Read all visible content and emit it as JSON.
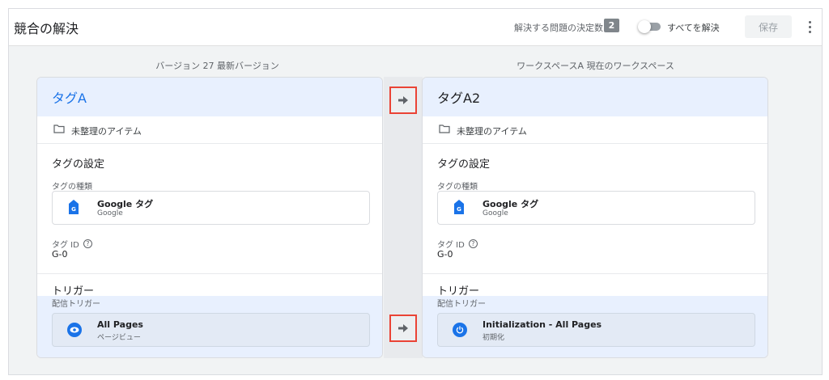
{
  "header": {
    "title": "競合の解決",
    "count_label": "解決する問題の決定数",
    "count_value": "2",
    "resolve_all_label": "すべてを解決",
    "save_label": "保存"
  },
  "columns": {
    "left_heading": "バージョン 27  最新バージョン",
    "right_heading": "ワークスペースA  現在のワークスペース"
  },
  "left": {
    "tag_name": "タグA",
    "folder": "未整理のアイテム",
    "settings_title": "タグの設定",
    "type_label": "タグの種類",
    "tag_type_name": "Google タグ",
    "tag_type_sub": "Google",
    "id_label": "タグ ID",
    "id_value": "G-0",
    "trigger_title": "トリガー",
    "firing_label": "配信トリガー",
    "trigger_name": "All Pages",
    "trigger_sub": "ページビュー",
    "trigger_icon": "eye-icon"
  },
  "right": {
    "tag_name": "タグA2",
    "folder": "未整理のアイテム",
    "settings_title": "タグの設定",
    "type_label": "タグの種類",
    "tag_type_name": "Google タグ",
    "tag_type_sub": "Google",
    "id_label": "タグ ID",
    "id_value": "G-0",
    "trigger_title": "トリガー",
    "firing_label": "配信トリガー",
    "trigger_name": "Initialization - All Pages",
    "trigger_sub": "初期化",
    "trigger_icon": "power-icon"
  },
  "colors": {
    "accent": "#1a73e8",
    "highlight": "#ea4335",
    "row_highlight": "#e8f0fe"
  }
}
